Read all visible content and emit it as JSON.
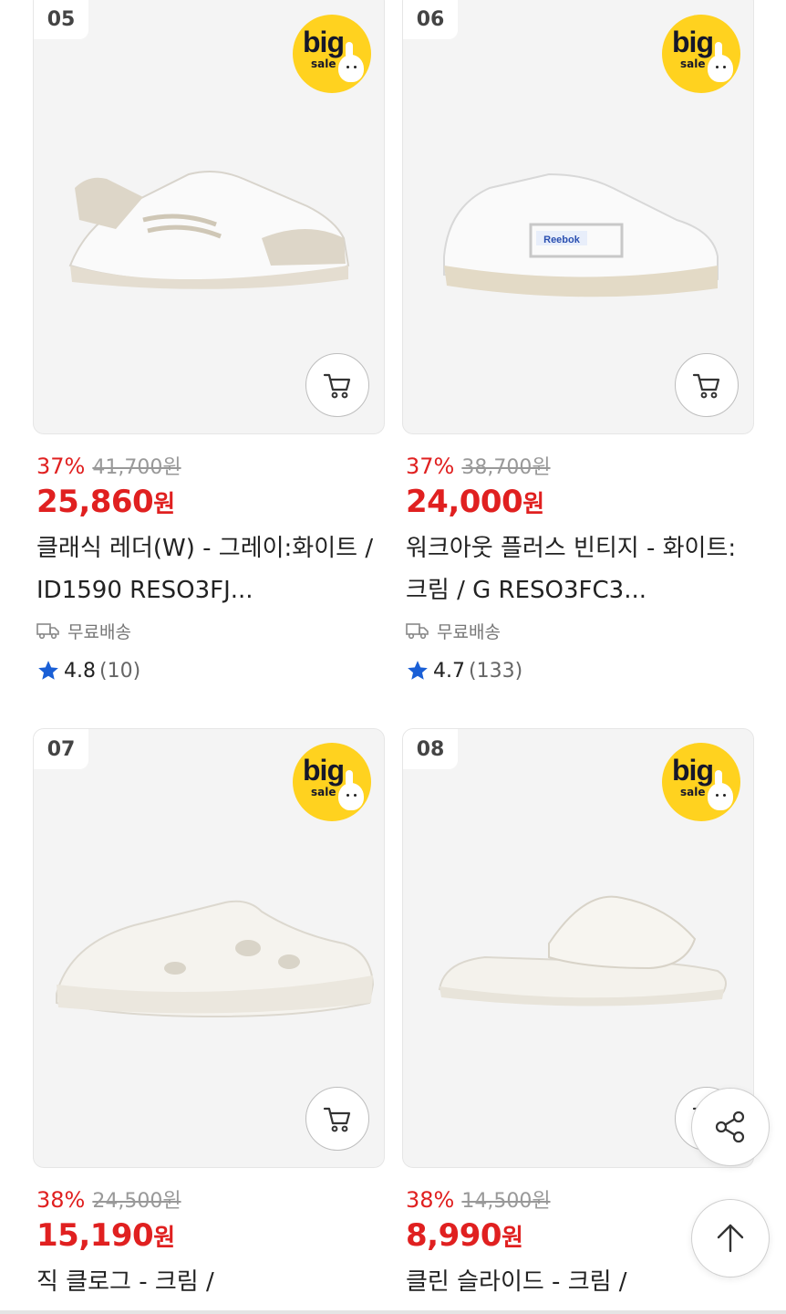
{
  "products": [
    {
      "rank": "05",
      "badge": {
        "big": "big",
        "sale": "sale"
      },
      "discount": "37%",
      "original_price": "41,700원",
      "price": "25,860",
      "currency": "원",
      "name": "클래식 레더(W) - 그레이:화이트 / ID1590 RESO3FJ...",
      "shipping": "무료배송",
      "rating": "4.8",
      "review_count": "(10)"
    },
    {
      "rank": "06",
      "badge": {
        "big": "big",
        "sale": "sale"
      },
      "discount": "37%",
      "original_price": "38,700원",
      "price": "24,000",
      "currency": "원",
      "name": "워크아웃 플러스 빈티지 - 화이트:크림 / G RESO3FC3...",
      "shipping": "무료배송",
      "rating": "4.7",
      "review_count": "(133)"
    },
    {
      "rank": "07",
      "badge": {
        "big": "big",
        "sale": "sale"
      },
      "discount": "38%",
      "original_price": "24,500원",
      "price": "15,190",
      "currency": "원",
      "name": "직 클로그 - 크림 /"
    },
    {
      "rank": "08",
      "badge": {
        "big": "big",
        "sale": "sale"
      },
      "discount": "38%",
      "original_price": "14,500원",
      "price": "8,990",
      "currency": "원",
      "name": "클린 슬라이드 - 크림 /"
    }
  ],
  "colors": {
    "accent": "#e02020",
    "badge_yellow": "#ffd21f",
    "star": "#1a5fd6"
  },
  "icons": {
    "cart": "cart-icon",
    "share": "share-icon",
    "scroll_top": "arrow-up-icon",
    "shipping": "truck-icon",
    "star": "star-icon"
  }
}
